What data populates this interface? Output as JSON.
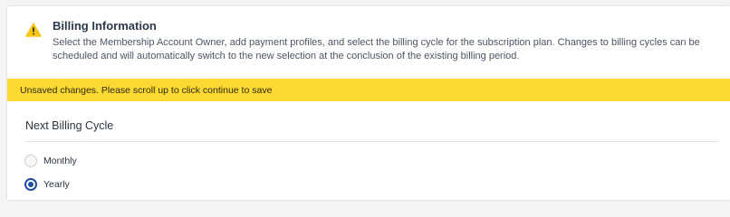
{
  "billing_info": {
    "icon": "warning-icon",
    "title": "Billing Information",
    "description": "Select the Membership Account Owner, add payment profiles, and select the billing cycle for the subscription plan. Changes to billing cycles can be scheduled and will automatically switch to the new selection at the conclusion of the existing billing period."
  },
  "banner": {
    "text": "Unsaved changes. Please scroll up to click continue to save",
    "color": "#fcd832"
  },
  "billing_cycle": {
    "title": "Next Billing Cycle",
    "options": [
      {
        "label": "Monthly",
        "selected": false
      },
      {
        "label": "Yearly",
        "selected": true
      }
    ],
    "selected_color": "#1d4ea0"
  },
  "colors": {
    "warning_icon": "#f5c518"
  }
}
